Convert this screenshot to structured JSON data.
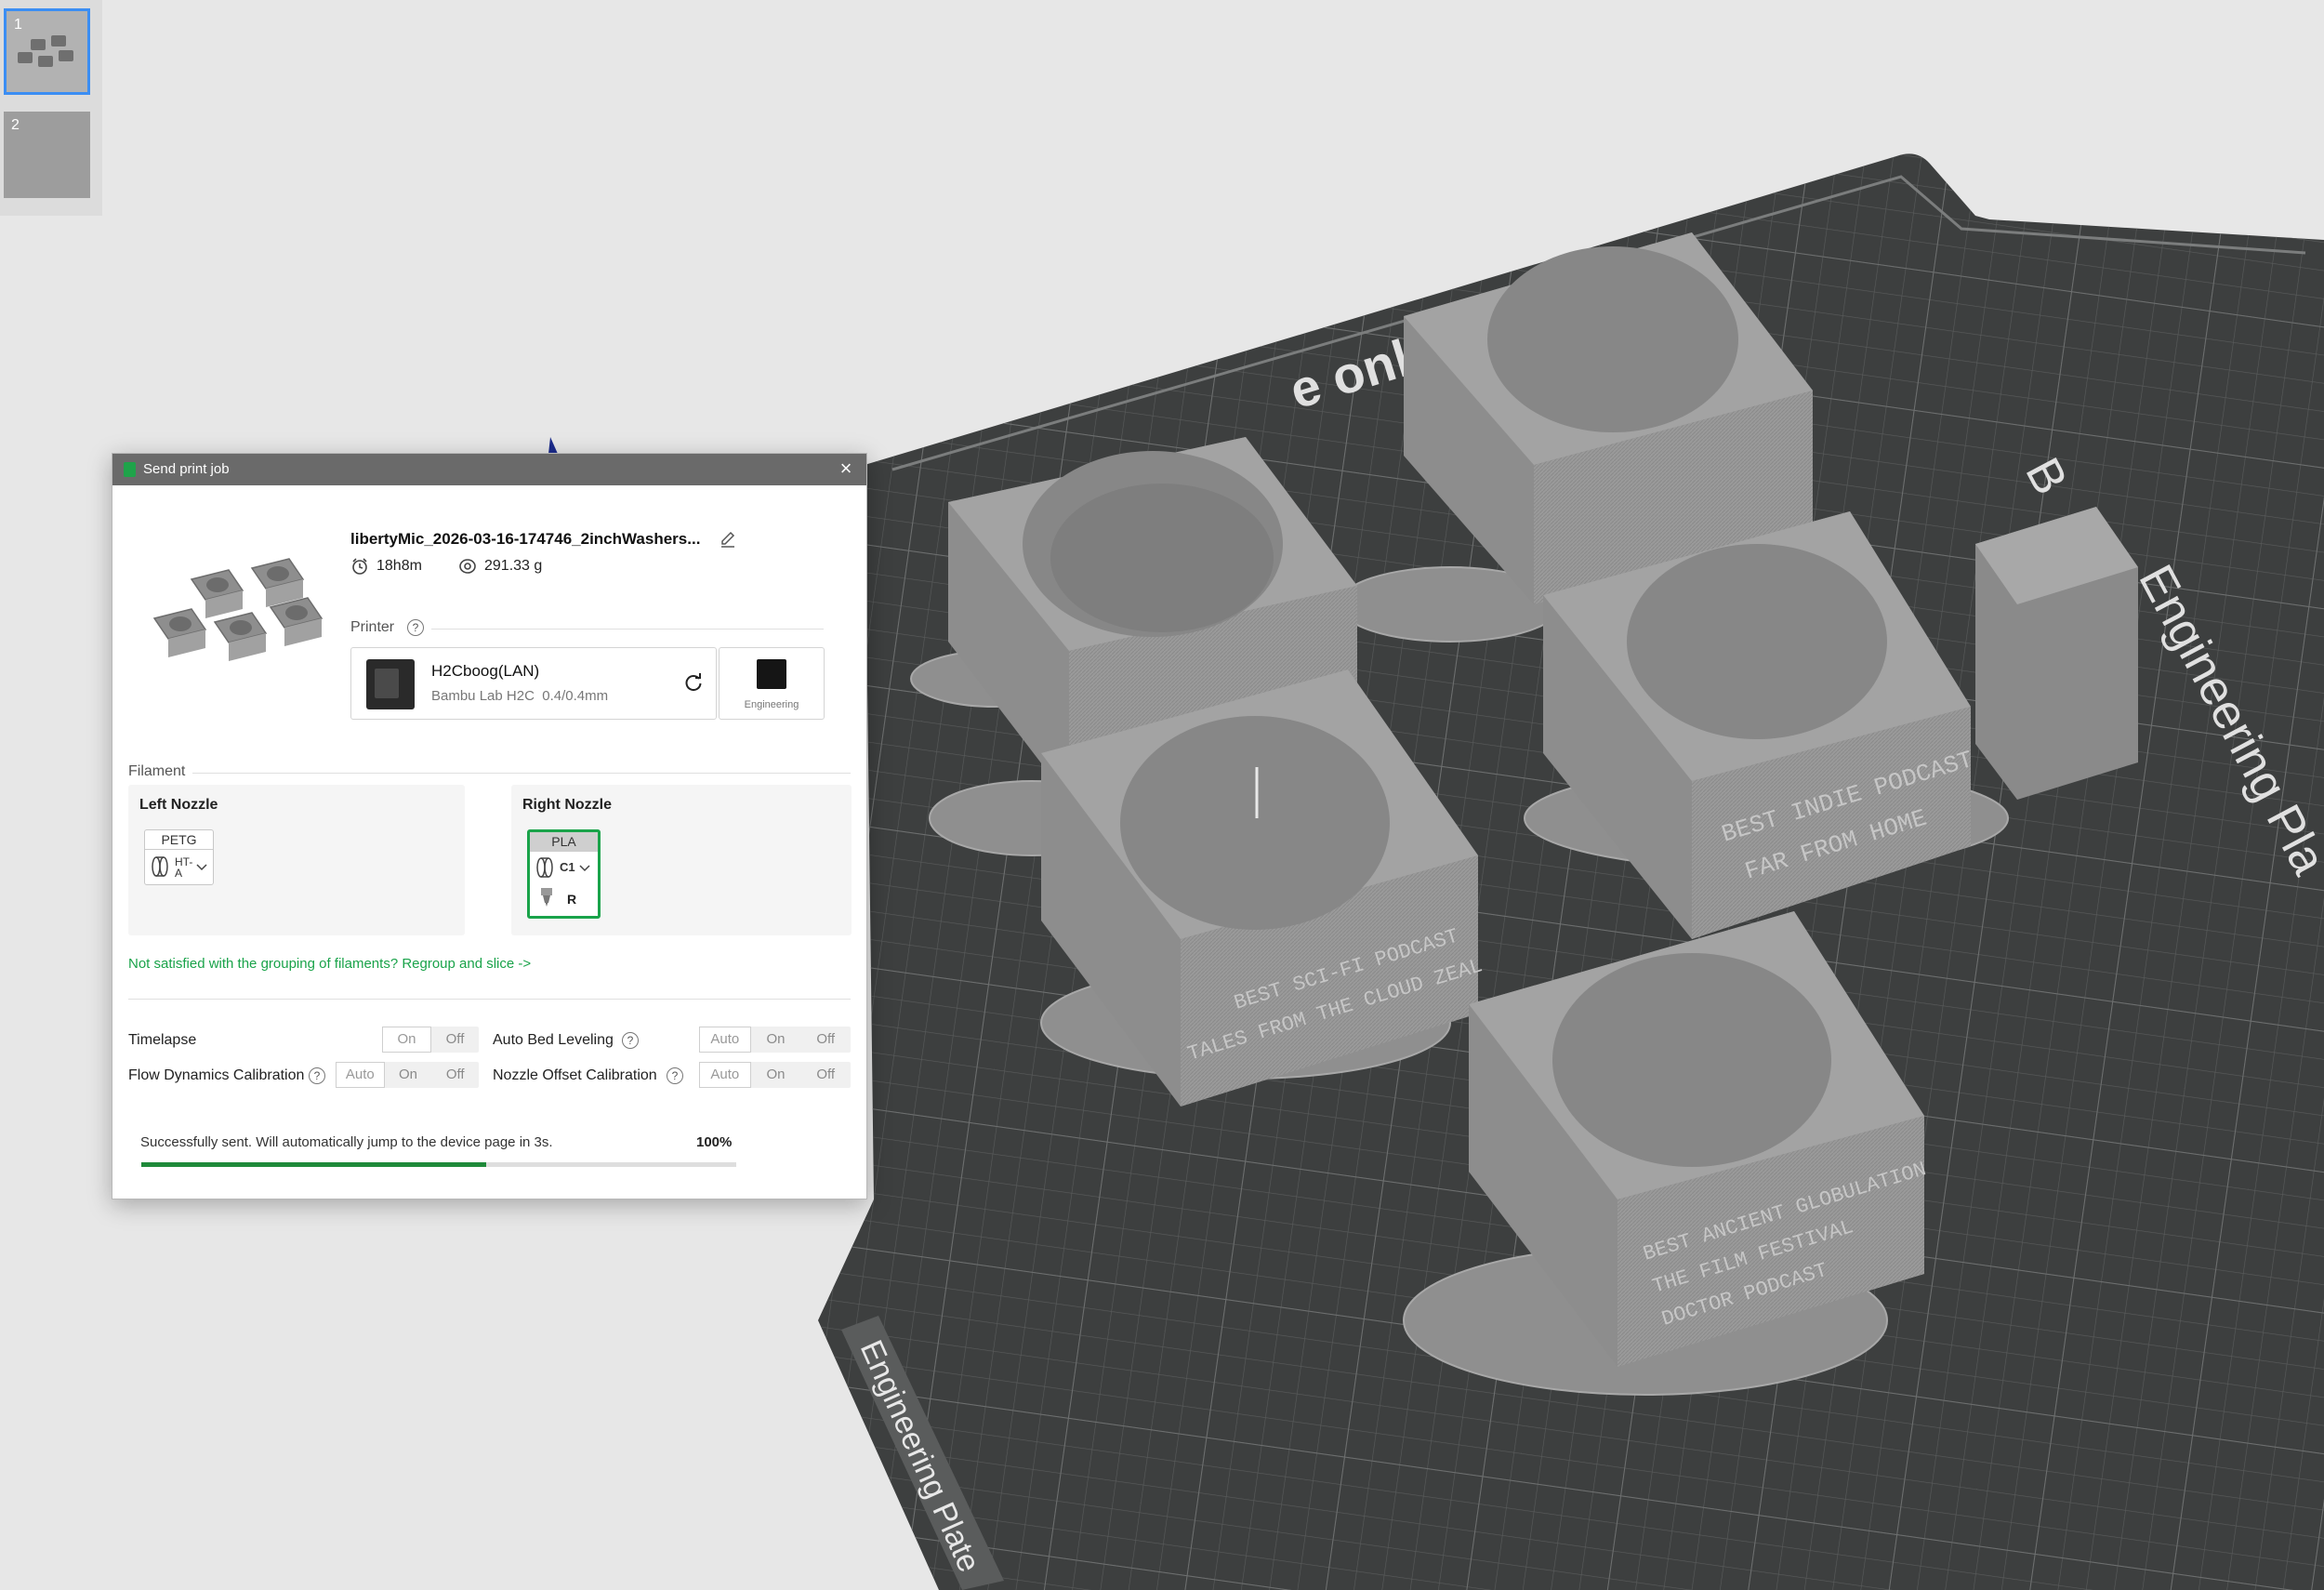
{
  "plates": [
    {
      "number": "1",
      "active": true
    },
    {
      "number": "2",
      "active": false
    }
  ],
  "bed": {
    "top_label": "e only",
    "right_label": "Engineering Pla",
    "right_label_prefix": "B",
    "bottom_label": "Engineering Plate",
    "model_texts": [
      "BEST INDIE PODCAST",
      "FAR FROM HOME",
      "BEST SCI-FI PODCAST",
      "TALES FROM THE CLOUD ZEAL",
      "BEST ANCIENT GLOBULATION",
      "THE FILM FESTIVAL",
      "DOCTOR PODCAST"
    ]
  },
  "dialog": {
    "title": "Send print job",
    "job_name": "libertyMic_2026-03-16-174746_2inchWashers...",
    "print_time": "18h8m",
    "weight": "291.33 g",
    "printer_label": "Printer",
    "printer": {
      "name": "H2Cboog(LAN)",
      "model": "Bambu Lab H2C",
      "nozzle": "0.4/0.4mm"
    },
    "plate_type": "Engineering",
    "filament_label": "Filament",
    "left_nozzle": {
      "title": "Left Nozzle",
      "filament": "PETG",
      "slot": "HT-A"
    },
    "right_nozzle": {
      "title": "Right Nozzle",
      "filament": "PLA",
      "slot": "C1",
      "nozzle_tag": "R"
    },
    "regroup_link": "Not satisfied with the grouping of filaments? Regroup and slice ->",
    "options": {
      "timelapse": {
        "label": "Timelapse",
        "choices": [
          "On",
          "Off"
        ]
      },
      "auto_bed_leveling": {
        "label": "Auto Bed Leveling",
        "choices": [
          "Auto",
          "On",
          "Off"
        ]
      },
      "flow_dynamics": {
        "label": "Flow Dynamics Calibration",
        "choices": [
          "Auto",
          "On",
          "Off"
        ]
      },
      "nozzle_offset": {
        "label": "Nozzle Offset Calibration",
        "choices": [
          "Auto",
          "On",
          "Off"
        ]
      }
    },
    "status": {
      "message": "Successfully sent. Will automatically jump to the device page in 3s.",
      "percent_text": "100%",
      "progress_fraction": 0.58
    }
  },
  "colors": {
    "accent_green": "#1aa34a",
    "progress_green": "#1f8a3a",
    "selection_blue": "#3b8ef3",
    "bed_dark": "#3d3f3f"
  }
}
